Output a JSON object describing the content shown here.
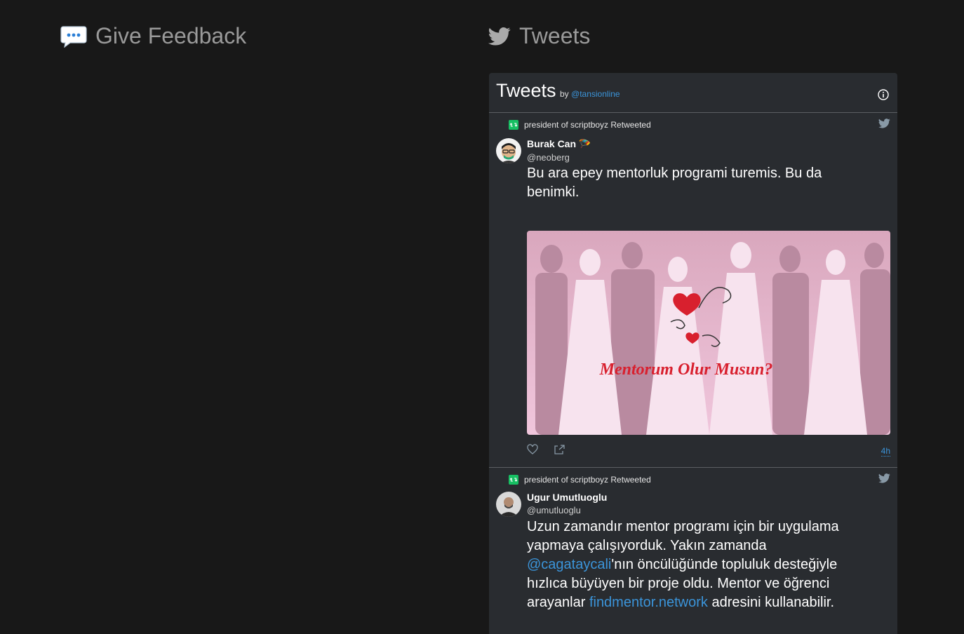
{
  "sections": {
    "feedback_title": "Give Feedback",
    "tweets_title": "Tweets"
  },
  "timeline": {
    "title": "Tweets",
    "by_label": "by",
    "handle": "@tansionline"
  },
  "tweets": [
    {
      "retweet_label": "president of scriptboyz Retweeted",
      "author_name": "Burak Can 🪂",
      "author_handle": "@neoberg",
      "text": "Bu ara epey mentorluk programi turemis. Bu da benimki.",
      "media_caption": "Mentorum Olur Musun?",
      "timestamp": "4h"
    },
    {
      "retweet_label": "president of scriptboyz Retweeted",
      "author_name": "Ugur Umutluoglu",
      "author_handle": "@umutluoglu",
      "text_part1": "Uzun zamandır mentor programı için bir uygulama yapmaya çalışıyorduk. Yakın zamanda ",
      "mention": "@cagataycali",
      "text_part2": "'nın öncülüğünde topluluk desteğiyle hızlıca büyüyen bir proje oldu. Mentor ve öğrenci arayanlar ",
      "link": "findmentor.network",
      "text_part3": " adresini kullanabilir."
    }
  ],
  "colors": {
    "background": "#181818",
    "card": "#292c30",
    "link": "#3b94d9",
    "retweet": "#17bf63"
  },
  "icons": [
    "speech-bubble-icon",
    "twitter-bird-icon",
    "info-icon",
    "retweet-icon",
    "heart-icon",
    "share-icon"
  ]
}
